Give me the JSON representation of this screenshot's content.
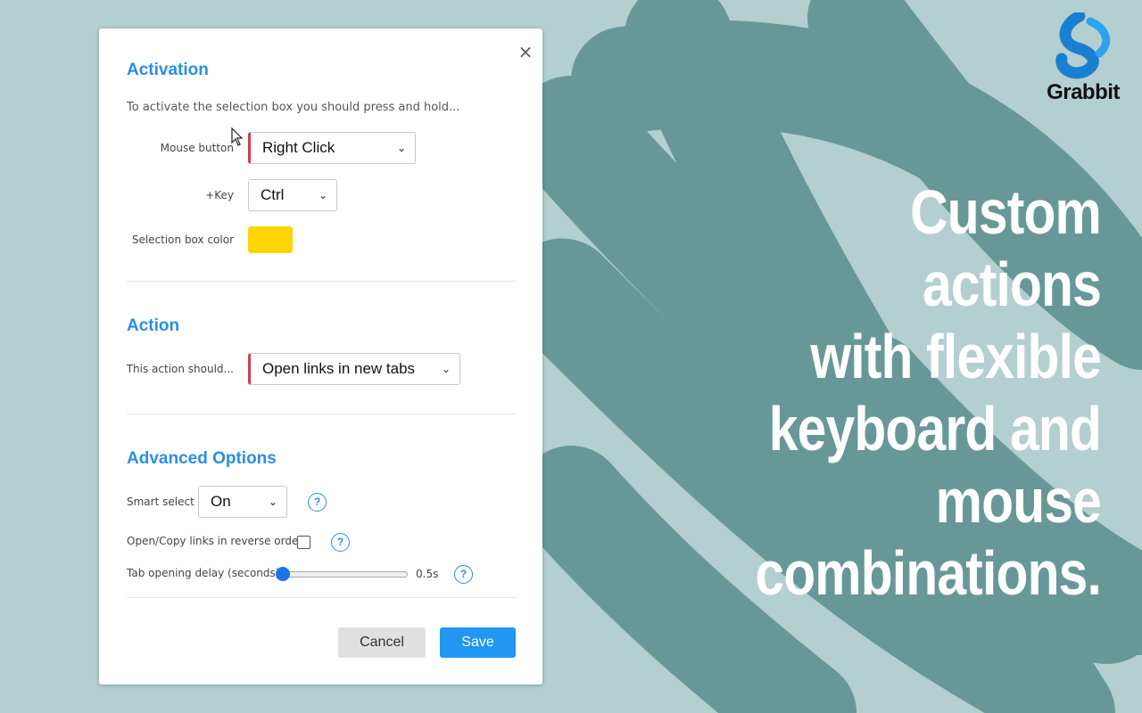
{
  "brand": {
    "name": "Grabbit"
  },
  "headline": {
    "lines": [
      "Custom actions",
      "with flexible",
      "keyboard and",
      "mouse",
      "combinations."
    ]
  },
  "dialog": {
    "close_label": "×",
    "activation": {
      "heading": "Activation",
      "note": "To activate the selection box you should press and hold...",
      "mouse_button_label": "Mouse button",
      "mouse_button_value": "Right Click",
      "key_label": "+Key",
      "key_value": "Ctrl",
      "color_label": "Selection box color",
      "color_value": "#ffd400"
    },
    "action": {
      "heading": "Action",
      "label": "This action should...",
      "value": "Open links in new tabs"
    },
    "advanced": {
      "heading": "Advanced Options",
      "smart_select_label": "Smart select",
      "smart_select_value": "On",
      "reverse_order_label": "Open/Copy links in reverse order",
      "reverse_order_checked": false,
      "delay_label": "Tab opening delay (seconds)",
      "delay_value": "0.5s",
      "help_glyph": "?"
    },
    "buttons": {
      "cancel": "Cancel",
      "save": "Save"
    }
  },
  "colors": {
    "background": "#b3cfcf",
    "shape": "#679897",
    "accent": "#2a8ee6",
    "save_button": "#2196f3",
    "required_marker": "#d63b4a"
  }
}
